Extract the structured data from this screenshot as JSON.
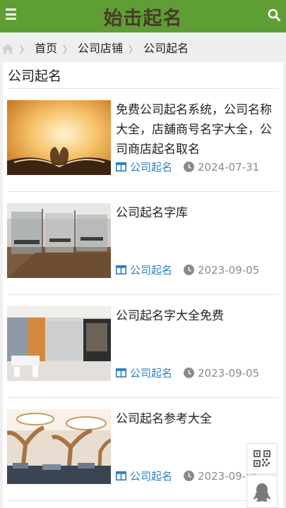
{
  "header": {
    "logo": "始击起名",
    "menu_icon": "menu-icon",
    "search_icon": "search-icon",
    "color": "#5f9e35"
  },
  "breadcrumb": {
    "items": [
      "首页",
      "公司店铺",
      "公司起名"
    ]
  },
  "section": {
    "title": "公司起名"
  },
  "articles": [
    {
      "title": "免费公司起名系统，公司名称大全，店舖商号名字大全，公司商店起名取名",
      "category": "公司起名",
      "date": "2024-07-31"
    },
    {
      "title": "公司起名字库",
      "category": "公司起名",
      "date": "2023-09-05"
    },
    {
      "title": "公司起名字大全免费",
      "category": "公司起名",
      "date": "2023-09-05"
    },
    {
      "title": "公司起名参考大全",
      "category": "公司起名",
      "date": "2023-09-05"
    }
  ],
  "floating": {
    "qr_icon": "qr-code-icon",
    "qq_icon": "qq-penguin-icon"
  },
  "colors": {
    "accent": "#2c7fc4",
    "date": "#8a8a8a"
  }
}
